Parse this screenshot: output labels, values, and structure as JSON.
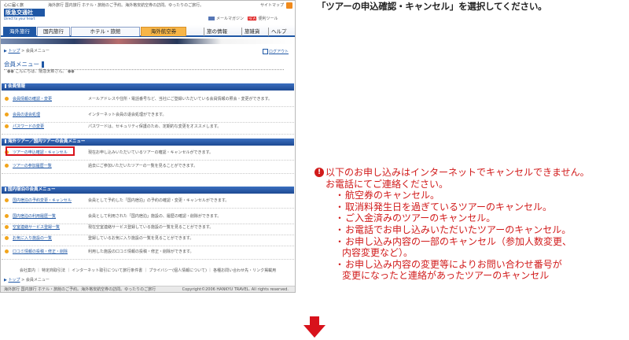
{
  "screenshot": {
    "header": {
      "logo_tag": "心に届く旅",
      "logo_name": "阪急交通社",
      "logo_sub": "Direct to your heart",
      "top_note": "海外旅行 国内旅行 ホテル・旅館のご予約。海外格安航空券の訪問。ゆったりのご旅行。",
      "sitemap": "サイトマップ",
      "mail_magazine": "メールマガジン",
      "download": "便利ツール"
    },
    "nav": {
      "tabs": [
        "海外旅行",
        "国内旅行",
        "ホテル・旅館",
        "海外航空券"
      ],
      "links": [
        "旅の情報",
        "旅雑貨",
        "ヘルプ"
      ]
    },
    "breadcrumb": {
      "top": "トップ",
      "sep": ">",
      "current": "会員メニュー"
    },
    "logout": "ログアウト",
    "page_title": "会員メニュー",
    "greeting": "こんにちは、阪急太郎さん。",
    "sections": [
      {
        "title": "会員情報",
        "rows": [
          {
            "link": "会員情報の確認・変更",
            "desc": "メールアドレスや住所・電話番号など、当社にご登録いただいている会員情報の照会・変更ができます。"
          },
          {
            "link": "会員の退会処理",
            "desc": "インターネット会員の退会処理ができます。"
          },
          {
            "link": "パスワードの変更",
            "desc": "パスワードは、セキュリティ保護のため、定期的な変更をオススメします。"
          }
        ]
      },
      {
        "title": "海外ツアー／国内ツアーの会員メニュー",
        "rows": [
          {
            "link": "ツアーの申込確認・キャンセル",
            "desc": "現在お申し込みいただいているツアーの確認・キャンセルができます。"
          },
          {
            "link": "ツアーの参加履歴一覧",
            "desc": "過去にご参加いただいたツアーの一覧を見ることができます。"
          }
        ]
      },
      {
        "title": "国内宿泊の会員メニュー",
        "rows": [
          {
            "link": "国内宿泊の予約変更・キャンセル",
            "desc": "会員として予約した「国内宿泊」の予約の確認・変更・キャンセルができます。"
          },
          {
            "link": "国内宿泊の利用履歴一覧",
            "desc": "会員として利用された「国内宿泊」施設の、履歴の確認・削除ができます。"
          },
          {
            "link": "空室連絡サービス登録一覧",
            "desc": "現在空室連絡サービス登録している施設の一覧を見ることができます。"
          },
          {
            "link": "お気に入り施設の一覧",
            "desc": "登録しているお気に入り施設の一覧を見ることができます。"
          },
          {
            "link": "口コミ情報の投稿・修正・削除",
            "desc": "利用した施設の口コミ情報の投稿・修正・削除ができます。"
          }
        ]
      }
    ],
    "footer_links": "会社案内 ｜ 特定商取引法 ｜ インターネット取引について旅行条件書 ｜ プライバシー(個人情報について) ｜ 各種お問い合わせ先・リンク掲載用",
    "breadcrumb_bottom": {
      "top": "トップ",
      "sep": ">",
      "current": "会員メニュー"
    },
    "copyright_left": "海外旅行 国内旅行 ホテル・旅館のご予約。海外格安航空券の訪問。ゆったりのご旅行",
    "copyright_right": "Copyright©2006 HANKYU TRAVEL. All rights reserved."
  },
  "instruction": "「ツアーの申込確認・キャンセル」を選択してください。",
  "note": {
    "icon": "!",
    "line1": "以下のお申し込みはインターネットでキャンセルできません。",
    "line2": "お電話にてご連絡ください。",
    "items": [
      {
        "bullet": "・",
        "text": "航空券のキャンセル。"
      },
      {
        "bullet": "・",
        "text": "取消料発生日を過ぎているツアーのキャンセル。"
      },
      {
        "bullet": "・",
        "text": "ご入金済みのツアーのキャンセル。"
      },
      {
        "bullet": "・",
        "text": "お電話でお申し込みいただいたツアーのキャンセル。"
      },
      {
        "bullet": "・",
        "text": "お申し込み内容の一部のキャンセル（参加人数変更、",
        "cont": "内容変更など）。"
      },
      {
        "bullet": "・",
        "text": "お申し込み内容の変更等によりお問い合わせ番号が",
        "cont": "変更になったと連絡があったツアーのキャンセル"
      }
    ]
  },
  "colors": {
    "accent": "#1f57a5",
    "highlight": "#d8121b",
    "note": "#d11a1a",
    "bullet": "#f2a51c"
  },
  "icons": {
    "note": "exclamation-circle-icon",
    "arrow": "arrow-down-icon"
  }
}
